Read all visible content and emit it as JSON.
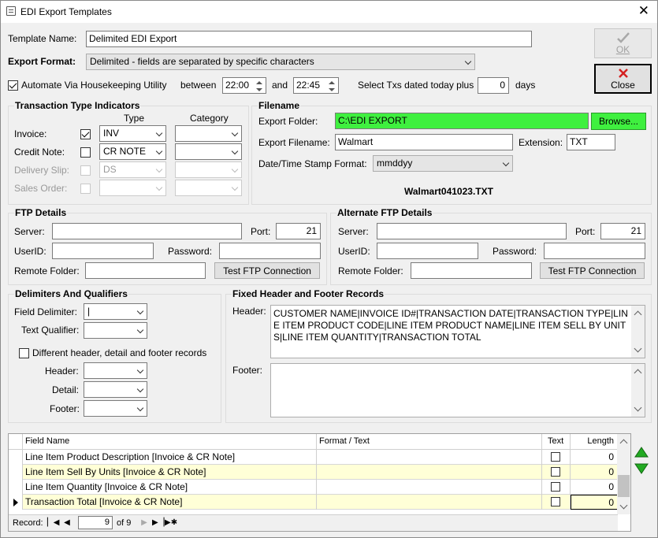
{
  "window": {
    "title": "EDI Export Templates",
    "close": "✕"
  },
  "template": {
    "name_label": "Template Name:",
    "name_value": "Delimited EDI Export"
  },
  "export_format": {
    "label": "Export Format:",
    "value": "Delimited - fields are separated by specific characters"
  },
  "automate": {
    "label": "Automate Via Housekeeping Utility",
    "checked": true,
    "between_label": "between",
    "start_time": "22:00",
    "and_label": "and",
    "end_time": "22:45",
    "select_label": "Select Txs dated today plus",
    "days_value": "0",
    "days_label": "days"
  },
  "buttons": {
    "ok": "OK",
    "close": "Close"
  },
  "transaction_types": {
    "title": "Transaction Type Indicators",
    "type_header": "Type",
    "category_header": "Category",
    "rows": [
      {
        "label": "Invoice:",
        "checked": true,
        "type": "INV",
        "enabled": true
      },
      {
        "label": "Credit Note:",
        "checked": false,
        "type": "CR NOTE",
        "enabled": true
      },
      {
        "label": "Delivery Slip:",
        "checked": false,
        "type": "DS",
        "enabled": false
      },
      {
        "label": "Sales Order:",
        "checked": false,
        "type": "",
        "enabled": false
      }
    ]
  },
  "filename": {
    "title": "Filename",
    "folder_label": "Export Folder:",
    "folder_value": "C:\\EDI EXPORT",
    "browse": "Browse...",
    "file_label": "Export Filename:",
    "file_value": "Walmart",
    "ext_label": "Extension:",
    "ext_value": "TXT",
    "stamp_label": "Date/Time Stamp Format:",
    "stamp_value": "mmddyy",
    "preview": "Walmart041023.TXT",
    "folder_color": "#3ff03f"
  },
  "ftp": {
    "title": "FTP Details",
    "server_label": "Server:",
    "port_label": "Port:",
    "port_value": "21",
    "user_label": "UserID:",
    "password_label": "Password:",
    "remote_label": "Remote Folder:",
    "test": "Test FTP Connection"
  },
  "alt_ftp": {
    "title": "Alternate FTP Details",
    "server_label": "Server:",
    "port_label": "Port:",
    "port_value": "21",
    "user_label": "UserID:",
    "password_label": "Password:",
    "remote_label": "Remote Folder:",
    "test": "Test FTP Connection"
  },
  "delimiters": {
    "title": "Delimiters And Qualifiers",
    "field_label": "Field Delimiter:",
    "field_value": "|",
    "text_label": "Text Qualifier:",
    "different_label": "Different header, detail and footer records",
    "header_label": "Header:",
    "detail_label": "Detail:",
    "footer_label": "Footer:"
  },
  "fixed_records": {
    "title": "Fixed Header and Footer Records",
    "header_label": "Header:",
    "header_value": "CUSTOMER NAME|INVOICE ID#|TRANSACTION DATE|TRANSACTION TYPE|LINE ITEM PRODUCT CODE|LINE ITEM PRODUCT NAME|LINE ITEM SELL BY UNITS|LINE ITEM QUANTITY|TRANSACTION TOTAL",
    "footer_label": "Footer:"
  },
  "grid": {
    "columns": [
      "Field Name",
      "Format / Text",
      "Text",
      "Length"
    ],
    "rows": [
      {
        "field": "Line Item Product Description [Invoice & CR Note]",
        "format": "",
        "length": "0",
        "highlight": false,
        "current": false
      },
      {
        "field": "Line Item Sell By Units [Invoice & CR Note]",
        "format": "",
        "length": "0",
        "highlight": true,
        "current": false
      },
      {
        "field": "Line Item Quantity [Invoice & CR Note]",
        "format": "",
        "length": "0",
        "highlight": false,
        "current": false
      },
      {
        "field": "Transaction Total [Invoice & CR Note]",
        "format": "",
        "length": "0",
        "highlight": true,
        "current": true
      }
    ],
    "record_label": "Record:",
    "record_current": "9",
    "record_of": "of 9",
    "highlight_color": "#ffffd7"
  }
}
